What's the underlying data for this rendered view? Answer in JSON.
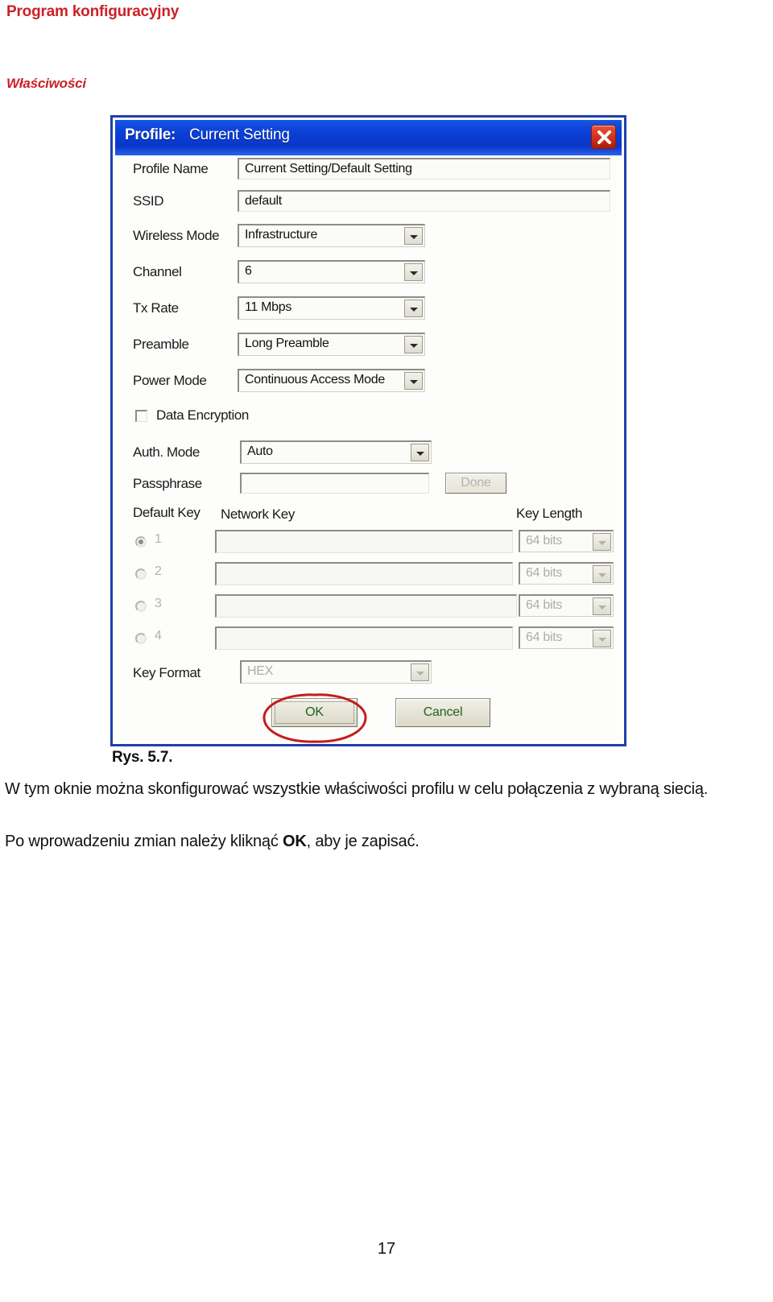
{
  "document": {
    "header_title": "Program konfiguracyjny",
    "section_title": "Właściwości",
    "figure_caption": "Rys. 5.7.",
    "paragraph_1": "W tym oknie można skonfigurować wszystkie właściwości profilu w celu połączenia z wybraną siecią.",
    "paragraph_2_before": "Po wprowadzeniu zmian należy kliknąć ",
    "paragraph_2_bold": "OK",
    "paragraph_2_after": ", aby je zapisać.",
    "page_number": "17"
  },
  "dialog": {
    "titlebar": {
      "label": "Profile:",
      "value": "Current Setting",
      "close_icon": "close-icon"
    },
    "fields": {
      "profile_name_label": "Profile Name",
      "profile_name_value": "Current Setting/Default Setting",
      "ssid_label": "SSID",
      "ssid_value": "default",
      "wireless_mode_label": "Wireless Mode",
      "wireless_mode_value": "Infrastructure",
      "channel_label": "Channel",
      "channel_value": "6",
      "tx_rate_label": "Tx Rate",
      "tx_rate_value": "11 Mbps",
      "preamble_label": "Preamble",
      "preamble_value": "Long Preamble",
      "power_mode_label": "Power Mode",
      "power_mode_value": "Continuous Access Mode",
      "data_encryption_label": "Data Encryption",
      "data_encryption_checked": false,
      "auth_mode_label": "Auth. Mode",
      "auth_mode_value": "Auto",
      "passphrase_label": "Passphrase",
      "passphrase_value": "",
      "done_label": "Done",
      "key_format_label": "Key Format",
      "key_format_value": "HEX"
    },
    "key_table": {
      "default_key_header": "Default Key",
      "network_key_header": "Network Key",
      "key_length_header": "Key Length",
      "rows": [
        {
          "index": "1",
          "selected": true,
          "network_key": "",
          "key_length": "64 bits"
        },
        {
          "index": "2",
          "selected": false,
          "network_key": "",
          "key_length": "64 bits"
        },
        {
          "index": "3",
          "selected": false,
          "network_key": "",
          "key_length": "64 bits"
        },
        {
          "index": "4",
          "selected": false,
          "network_key": "",
          "key_length": "64 bits"
        }
      ]
    },
    "buttons": {
      "ok_label": "OK",
      "cancel_label": "Cancel"
    }
  },
  "colors": {
    "brand_red": "#cc2027",
    "titlebar_blue": "#0b3fd6",
    "frame_blue": "#1f3fa8",
    "annotation_red": "#c41c1c",
    "button_text_green": "#236023"
  }
}
